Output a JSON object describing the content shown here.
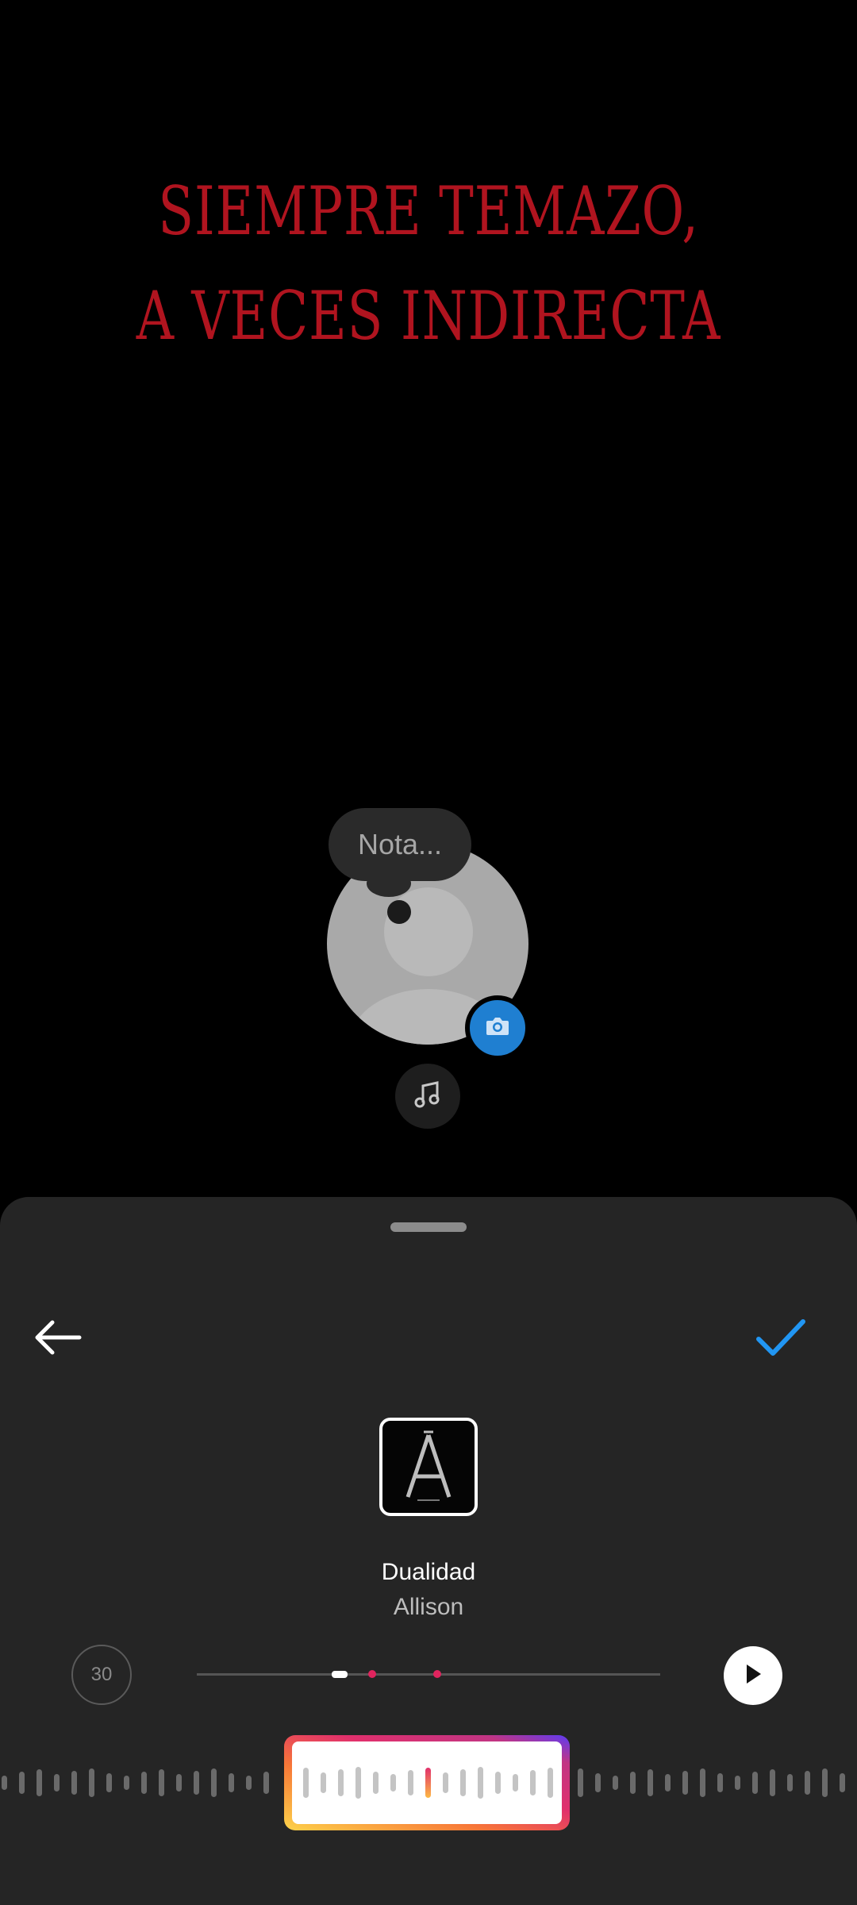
{
  "caption": {
    "line1": "Siempre temazo,",
    "line2": "a veces indirecta"
  },
  "note": {
    "placeholder": "Nota..."
  },
  "icons": {
    "camera": "camera-icon",
    "music": "music-note-icon",
    "back": "arrow-left-icon",
    "done": "checkmark-icon",
    "play": "play-icon"
  },
  "song": {
    "title": "Dualidad",
    "artist": "Allison"
  },
  "player": {
    "duration_label": "30",
    "markers_count": 2
  },
  "colors": {
    "caption": "#b0141f",
    "accent_blue": "#1f7fd1",
    "marker": "#e0245e",
    "sheet": "#252525"
  }
}
